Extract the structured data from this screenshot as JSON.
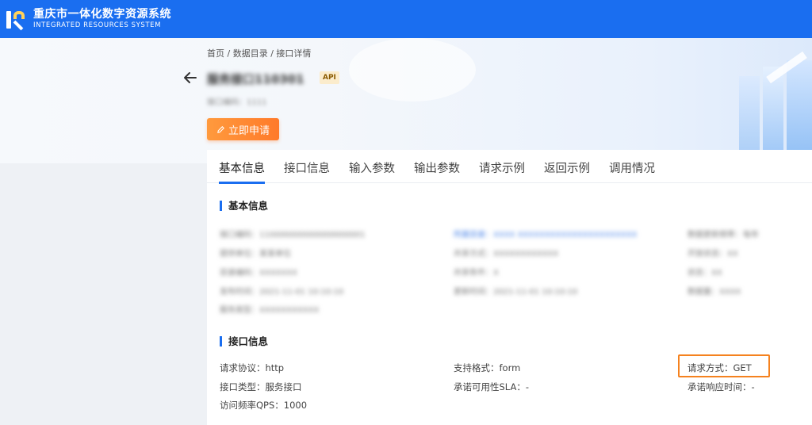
{
  "brand": {
    "name_cn": "重庆市一体化数字资源系统",
    "name_en": "INTEGRATED RESOURCES SYSTEM"
  },
  "breadcrumb": "首页 / 数据目录 / 接口详情",
  "api": {
    "title": "服务接口110301",
    "badge": "API",
    "subtitle": "接口编码：1111"
  },
  "actions": {
    "apply_label": "立即申请"
  },
  "tabs": [
    "基本信息",
    "接口信息",
    "输入参数",
    "输出参数",
    "请求示例",
    "返回示例",
    "调用情况"
  ],
  "basic_info": {
    "title": "基本信息",
    "blurred_rows": [
      [
        "接口编码：110000000000000000001",
        "所属目录：XXXX XXXXXXXXXXXXXXXXXXXXXX",
        "数据更新频率：每年"
      ],
      [
        "提供单位：某某单位",
        "共享方式：XXXXXXXXXXXX",
        "开放状态：XX"
      ],
      [
        "目录编码：XXXXXXX",
        "共享条件：X",
        "状态：XX"
      ],
      [
        "发布时间：2021-11-01 10:10:10",
        "更新时间：2021-11-01 10:10:10",
        "数据量：XXXX"
      ],
      [
        "服务类型：XXXXXXXXXXX",
        "",
        ""
      ]
    ]
  },
  "interface_info": {
    "title": "接口信息",
    "protocol": "请求协议：http",
    "format": "支持格式：form",
    "method": "请求方式：GET",
    "type": "接口类型：服务接口",
    "sla": "承诺可用性SLA：-",
    "response_time": "承诺响应时间：-",
    "qps": "访问频率QPS：1000"
  },
  "colors": {
    "primary": "#1a6ef0",
    "accent_orange": "#ff7a2a",
    "highlight": "#f5821f"
  }
}
